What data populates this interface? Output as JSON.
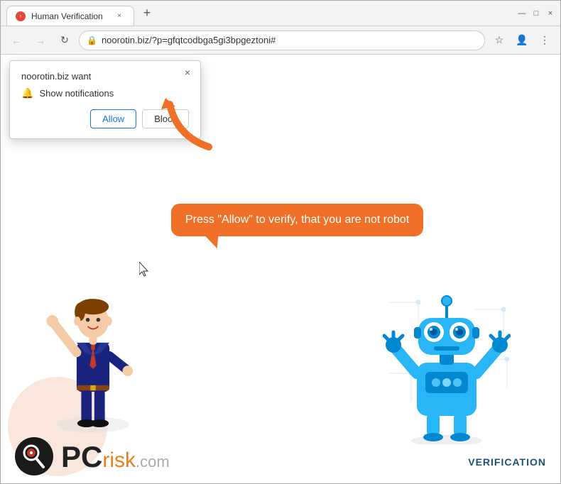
{
  "browser": {
    "tab": {
      "title": "Human Verification",
      "favicon": "⚠"
    },
    "url": "noorotin.biz/?p=gfqtcodbga5gi3bpgeztoni#",
    "url_display": "noorotin.biz/?p=gfqtcodbga5gi3bpgeztoni#"
  },
  "nav": {
    "back_label": "←",
    "forward_label": "→",
    "reload_label": "↻"
  },
  "popup": {
    "site": "noorotin.biz want",
    "notification_text": "Show notifications",
    "allow_label": "Allow",
    "block_label": "Block",
    "close_label": "×"
  },
  "bubble": {
    "text": "Press \"Allow\" to verify, that you are not robot"
  },
  "footer": {
    "pcrisk_pc": "PC",
    "pcrisk_risk": "risk",
    "pcrisk_domain": ".com",
    "verification": "VERIFICATION"
  },
  "window_controls": {
    "minimize": "—",
    "maximize": "□",
    "close": "×"
  }
}
